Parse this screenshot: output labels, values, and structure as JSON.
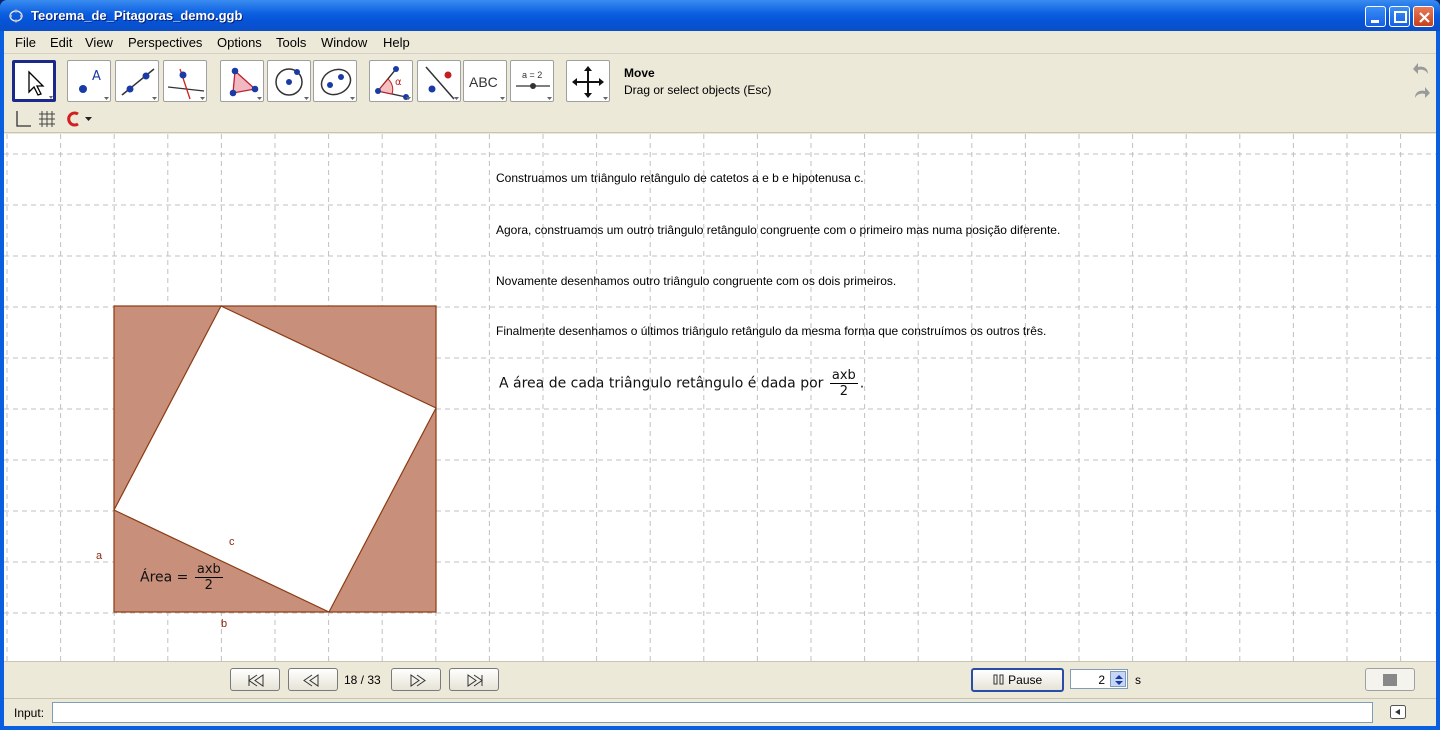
{
  "window": {
    "title": "Teorema_de_Pitagoras_demo.ggb",
    "icon": "geogebra-icon",
    "controls": [
      "minimize-icon",
      "maximize-icon",
      "close-icon"
    ]
  },
  "menu": [
    "File",
    "Edit",
    "View",
    "Perspectives",
    "Options",
    "Tools",
    "Window",
    "Help"
  ],
  "toolbar": {
    "tools": [
      {
        "name": "move-tool-icon",
        "selected": true
      },
      {
        "name": "point-tool-icon"
      },
      {
        "name": "line-tool-icon"
      },
      {
        "name": "perpendicular-line-tool-icon"
      },
      {
        "name": "polygon-tool-icon"
      },
      {
        "name": "circle-tool-icon"
      },
      {
        "name": "ellipse-tool-icon"
      },
      {
        "name": "angle-tool-icon"
      },
      {
        "name": "reflect-tool-icon"
      },
      {
        "name": "text-tool-icon",
        "label": "ABC"
      },
      {
        "name": "slider-tool-icon",
        "label": "a = 2"
      },
      {
        "name": "move-graphics-view-tool-icon"
      }
    ],
    "active_tool_name": "Move",
    "active_tool_help": "Drag or select objects (Esc)",
    "undo_icon": "undo-icon",
    "redo_icon": "redo-icon"
  },
  "stylebar": {
    "icons": [
      "axes-toggle-icon",
      "grid-toggle-icon",
      "point-capturing-icon",
      "dropdown-arrow-icon"
    ]
  },
  "graphics": {
    "texts": [
      "Construamos um triângulo retângulo de catetos a e b e hipotenusa c.",
      "Agora, construamos um outro triângulo retângulo congruente com o primeiro mas numa posição diferente.",
      "Novamente desenhamos outro triângulo congruente com os dois primeiros.",
      "Finalmente desenhamos o últimos triângulo retângulo da mesma forma que construímos os outros três."
    ],
    "area_sentence": {
      "prefix": "A área de cada triângulo retângulo é dada por",
      "numerator": "axb",
      "denominator": "2",
      "suffix": "."
    },
    "area_formula": {
      "prefix": "Área =",
      "numerator": "axb",
      "denominator": "2"
    },
    "segment_labels": {
      "a": "a",
      "b": "b",
      "c": "c"
    },
    "colors": {
      "triangle_fill": "#c8907a",
      "triangle_stroke": "#8b3a14",
      "grid": "#c0c0c0"
    }
  },
  "playback": {
    "first_icon": "first-slide-icon",
    "prev_icon": "previous-slide-icon",
    "counter": "18 / 33",
    "next_icon": "next-slide-icon",
    "last_icon": "last-slide-icon",
    "pause_label": "Pause",
    "pause_icon": "pause-icon",
    "interval_value": "2",
    "interval_unit": "s",
    "stop_icon": "stop-icon"
  },
  "input": {
    "label": "Input:",
    "value": "",
    "keyboard_icon": "keyboard-icon"
  }
}
